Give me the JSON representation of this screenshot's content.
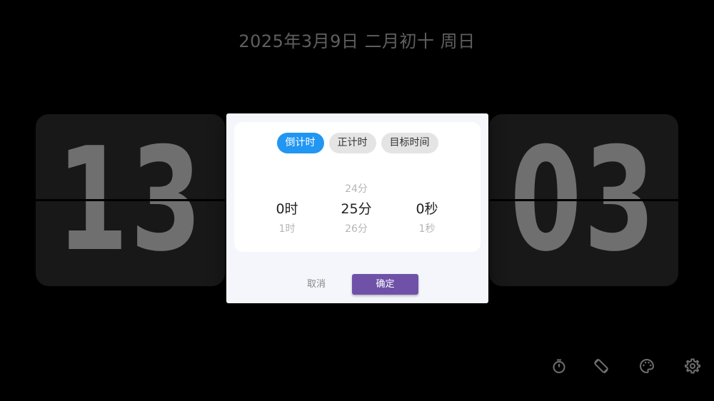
{
  "header": {
    "date_text": "2025年3月9日 二月初十 周日"
  },
  "clock": {
    "left_digits": "13",
    "right_digits": "03"
  },
  "dialog": {
    "tabs": [
      {
        "label": "倒计时",
        "active": true
      },
      {
        "label": "正计时",
        "active": false
      },
      {
        "label": "目标时间",
        "active": false
      }
    ],
    "picker": {
      "hours": {
        "above": "",
        "selected": "0时",
        "below": "1时"
      },
      "minutes": {
        "above": "24分",
        "selected": "25分",
        "below": "26分"
      },
      "seconds": {
        "above": "",
        "selected": "0秒",
        "below": "1秒"
      }
    },
    "cancel_label": "取消",
    "confirm_label": "确定"
  },
  "toolbar": {
    "icons": [
      "timer-icon",
      "screen-rotate-icon",
      "palette-icon",
      "gear-icon"
    ]
  },
  "colors": {
    "background": "#000000",
    "active_tab": "#2196f3",
    "confirm_button": "#6f52a8",
    "digit": "#6f6f6f"
  }
}
